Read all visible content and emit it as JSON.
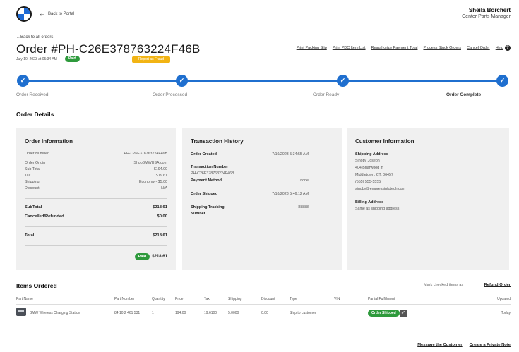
{
  "header": {
    "back_to_portal": "Back to Portal",
    "user_name": "Sheila Borchert",
    "user_role": "Center Parts Manager"
  },
  "order": {
    "back_to_orders": "←Back to all orders",
    "title": "Order #PH-C26E378763224F46B",
    "date": "July 10, 2023 at 05:34 AM",
    "paid_badge": "Paid",
    "report_button": "Report as Fraud"
  },
  "actions": [
    "Print Packing Slip",
    "Print PDC Item List",
    "Reauthorize Payment Total",
    "Process Stuck Orders",
    "Cancel Order",
    "Help"
  ],
  "help_icon": "?",
  "progress": {
    "steps": [
      "Order Received",
      "Order Processed",
      "Order Ready",
      "Order Complete"
    ],
    "current_index": 3,
    "check": "✓",
    "color": "#1f6fcf"
  },
  "details_title": "Order Details",
  "order_information": {
    "title": "Order Information",
    "rows": [
      {
        "label": "Order Number",
        "value": "PH-C26E378763224F46B"
      },
      {
        "label": "Order Origin",
        "value": "ShopBMWUSA.com"
      },
      {
        "label": "Sub Total",
        "value": "$194.00"
      },
      {
        "label": "Tax",
        "value": "$19.61"
      },
      {
        "label": "Shipping",
        "value": "Economy - $5.00"
      },
      {
        "label": "Discount",
        "value": "N/A"
      }
    ],
    "subtotal_label": "SubTotal",
    "subtotal_value": "$218.61",
    "cancelled_label": "Cancelled/Refunded",
    "cancelled_value": "$0.00",
    "total_label": "Total",
    "total_value": "$218.61",
    "paid_badge": "Paid",
    "paid_amount": "$218.61"
  },
  "transaction_history": {
    "title": "Transaction History",
    "order_created_label": "Order Created",
    "order_created_value": "7/10/2023 5:34:55 AM",
    "transaction_number_label": "Transaction Number",
    "transaction_number_value": "PH-C26E378763224F46B",
    "payment_method_label": "Payment Method",
    "payment_method_value": "none",
    "order_shipped_label": "Order Shipped",
    "order_shipped_value": "7/10/2023 5:46:12 AM",
    "tracking_label_1": "Shipping Tracking",
    "tracking_label_2": "Number",
    "tracking_value": "88888"
  },
  "customer_information": {
    "title": "Customer Information",
    "shipping_label": "Shipping Address",
    "address_lines": [
      "Sinoby Joseph",
      "404 Briarwood ln",
      "Middletown, CT, 06457",
      "(555) 555-5555",
      "sinoby@empressinfotech.com"
    ],
    "billing_label": "Billing Address",
    "billing_value": "Same as shipping address"
  },
  "items": {
    "title": "Items Ordered",
    "mark_text": "Mark checked items as",
    "refund_link": "Refund Order",
    "columns": [
      "Part Name",
      "Part Number",
      "Quantity",
      "Price",
      "Tax",
      "Shipping",
      "Discount",
      "Type",
      "VIN",
      "Partial Fulfillment",
      "Updated"
    ],
    "row": {
      "part_name": "BMW Wireless Charging Station",
      "part_number": "84 10 2 461 531",
      "quantity": "1",
      "price": "194.00",
      "tax": "19.6100",
      "shipping": "5.0000",
      "discount": "0.00",
      "type": "Ship to customer",
      "vin": "",
      "fulfillment_badge": "Order Shipped",
      "check": "✓",
      "updated": "Today"
    }
  },
  "footer": {
    "message_customer": "Message the Customer",
    "private_note": "Create a Private Note"
  },
  "colors": {
    "accent_blue": "#1f6fcf",
    "paid_green": "#2e9a3c",
    "report_yellow": "#f2b414",
    "panel_gray": "#f0f0f0"
  }
}
